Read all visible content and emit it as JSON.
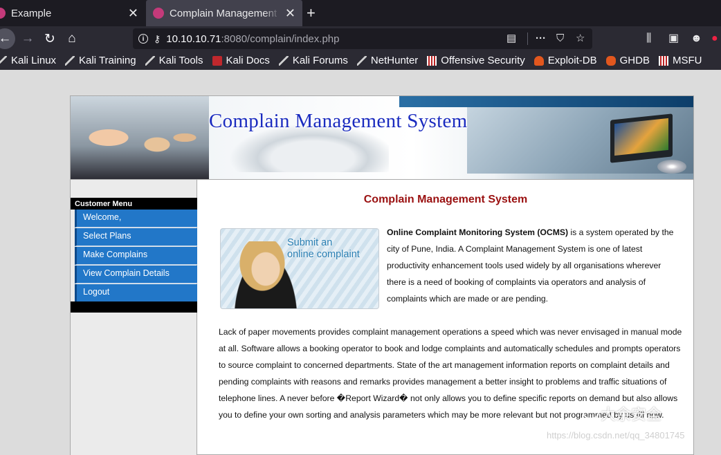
{
  "browser": {
    "tabs": [
      {
        "title": "Example",
        "active": false
      },
      {
        "title": "Complain Management S",
        "active": true
      }
    ],
    "url_host": "10.10.10.71",
    "url_rest": ":8080/complain/index.php",
    "bookmarks": [
      {
        "label": "Kali Linux",
        "icon": "kali-icon"
      },
      {
        "label": "Kali Training",
        "icon": "kali-icon"
      },
      {
        "label": "Kali Tools",
        "icon": "kali-icon"
      },
      {
        "label": "Kali Docs",
        "icon": "docs-icon"
      },
      {
        "label": "Kali Forums",
        "icon": "kali-icon"
      },
      {
        "label": "NetHunter",
        "icon": "nethunter-icon"
      },
      {
        "label": "Offensive Security",
        "icon": "offsec-icon"
      },
      {
        "label": "Exploit-DB",
        "icon": "exploitdb-icon"
      },
      {
        "label": "GHDB",
        "icon": "ghdb-icon"
      },
      {
        "label": "MSFU",
        "icon": "offsec-icon"
      }
    ]
  },
  "site": {
    "banner_title": "Complain Management System",
    "menu_title": "Customer Menu",
    "menu": [
      "Welcome,",
      "Select Plans",
      "Make Complains",
      "View Complain Details",
      "Logout"
    ],
    "content_title": "Complain Management System",
    "submit_line1": "Submit an",
    "submit_line2": "online complaint",
    "intro_bold": "Online Complaint Monitoring System (OCMS)",
    "intro_rest": " is a system operated by the city of Pune, India. A Complaint Management System is one of latest productivity enhancement tools used widely by all organisations wherever there is a need of booking of complaints via operators and analysis of complaints which are made or are pending.",
    "body": "Lack of paper movements provides complaint management operations a speed which was never envisaged in manual mode at all. Software allows a booking operator to book and lodge complaints and automatically schedules and prompts operators to source complaint to concerned departments. State of the art management information reports on complaint details and pending complaints with reasons and remarks provides management a better insight to problems and traffic situations of telephone lines. A never before �Report Wizard� not only allows you to define specific reports on demand but also allows you to define your own sorting and analysis parameters which may be more relevant but not programmed by us till now."
  },
  "watermark": {
    "text": "大余安全",
    "url": "https://blog.csdn.net/qq_34801745"
  }
}
